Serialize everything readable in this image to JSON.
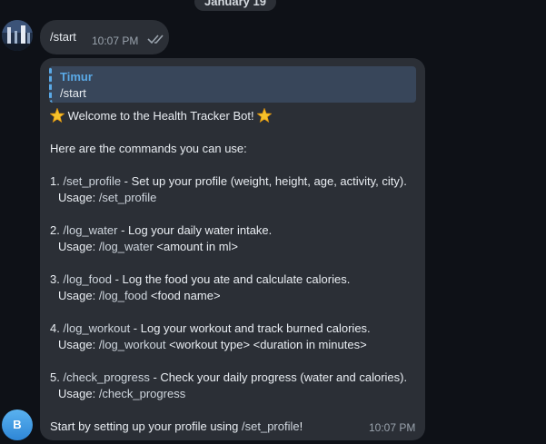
{
  "date_divider": "January 19",
  "user_message": {
    "text": "/start",
    "time": "10:07 PM"
  },
  "bot_message": {
    "reply_author": "Timur",
    "reply_text": "/start",
    "welcome": "Welcome to the Health Tracker Bot!",
    "intro": "Here are the commands you can use:",
    "commands": [
      {
        "num": "1.",
        "cmd": "/set_profile",
        "desc": " - Set up your profile (weight, height, age, activity, city).",
        "usage_label": "Usage: ",
        "usage_cmd": "/set_profile",
        "usage_args": ""
      },
      {
        "num": "2.",
        "cmd": "/log_water",
        "desc": " - Log your daily water intake.",
        "usage_label": "Usage: ",
        "usage_cmd": "/log_water",
        "usage_args": " <amount in ml>"
      },
      {
        "num": "3.",
        "cmd": "/log_food",
        "desc": " - Log the food you ate and calculate calories.",
        "usage_label": "Usage: ",
        "usage_cmd": "/log_food",
        "usage_args": " <food name>"
      },
      {
        "num": "4.",
        "cmd": "/log_workout",
        "desc": " - Log your workout and track burned calories.",
        "usage_label": "Usage: ",
        "usage_cmd": "/log_workout",
        "usage_args": " <workout type> <duration in minutes>"
      },
      {
        "num": "5.",
        "cmd": "/check_progress",
        "desc": " - Check your daily progress (water and calories).",
        "usage_label": "Usage: ",
        "usage_cmd": "/check_progress",
        "usage_args": ""
      }
    ],
    "footer_prefix": "Start by setting up your profile using ",
    "footer_cmd": "/set_profile",
    "footer_suffix": "!",
    "time": "10:07 PM"
  },
  "bot_avatar_letter": "B",
  "colors": {
    "background": "#0e1117",
    "bubble": "#2b2f36",
    "reply_bg": "#38465a",
    "accent": "#5aa9e6",
    "muted": "#9aa3ad"
  }
}
